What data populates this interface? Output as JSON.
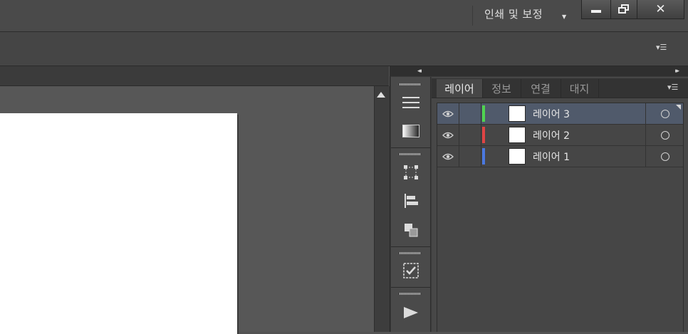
{
  "menubar": {
    "workspace_label": "인쇄 및 보정",
    "workspace_arrow_icon": "chevron-down-icon",
    "window_buttons": {
      "minimize_icon": "minimize-icon",
      "restore_icon": "restore-icon",
      "close_label": "✕"
    }
  },
  "control_bar": {
    "menu_icon": "panel-menu-icon",
    "menu_glyph": "▾☰"
  },
  "dock": {
    "collapse_left_glyph": "◂◂",
    "collapse_right_glyph": "▸▸",
    "tools": [
      "stroke-lines-icon",
      "gradient-icon",
      "transform-icon",
      "align-icon",
      "pathfinder-icon",
      "checklist-icon",
      "play-icon"
    ]
  },
  "layers_panel": {
    "tabs": [
      {
        "label": "레이어",
        "active": true
      },
      {
        "label": "정보",
        "active": false
      },
      {
        "label": "연결",
        "active": false
      },
      {
        "label": "대지",
        "active": false
      }
    ],
    "menu_glyph": "▾☰",
    "layers": [
      {
        "name": "레이어 3",
        "color": "#4fd44f",
        "selected": true,
        "visible": true
      },
      {
        "name": "레이어 2",
        "color": "#e04444",
        "selected": false,
        "visible": true
      },
      {
        "name": "레이어 1",
        "color": "#4a78e0",
        "selected": false,
        "visible": true
      }
    ]
  }
}
